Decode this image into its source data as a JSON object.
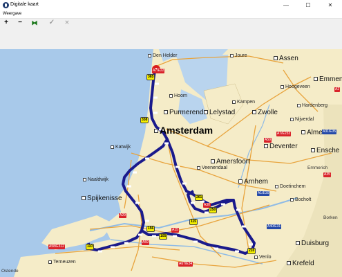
{
  "window": {
    "title": "Digitale kaart",
    "controls": [
      "—",
      "☐",
      "✕"
    ]
  },
  "menu": {
    "items": [
      "Weergave"
    ]
  },
  "toolbar": {
    "zoom_in": "+",
    "zoom_out": "−",
    "fit": "⧓",
    "confirm": "✓",
    "cancel": "✕"
  },
  "map": {
    "cities_large": {
      "amsterdam": "Amsterdam"
    },
    "cities_medium": {
      "purmerend": "Purmerend",
      "lelystad": "Lelystad",
      "zwolle": "Zwolle",
      "deventer": "Deventer",
      "amersfoort": "Amersfoort",
      "arnhem": "Arnhem",
      "spijkenisse": "Spijkenisse",
      "duisburg": "Duisburg",
      "krefeld": "Krefeld",
      "assen": "Assen",
      "almelo": "Almelo",
      "emmen": "Emmen",
      "enschede": "Ensche"
    },
    "towns": {
      "den_helder": "Den Helder",
      "joure": "Joure",
      "hoorn": "Hoorn",
      "kampen": "Kampen",
      "hoogeveen": "Hoogeveen",
      "hardenberg": "Hardenberg",
      "nijverdal": "Nijverdal",
      "katwijk": "Katwijk",
      "veenendaal": "Veenendaal",
      "naaldwijk": "Naaldwijk",
      "doetinchem": "Doetinchem",
      "bocholt": "Bocholt",
      "terneuzen": "Terneuzen",
      "venlo": "Venlo",
      "oostende": "Ostende",
      "borken": "Borken",
      "emmerich": "Emmerich"
    },
    "shields": {
      "a7e22": "A7/E22",
      "a7e233": "A7/E233",
      "a50": "A50",
      "a35": "A35",
      "a1e30": "A1/E30",
      "a29": "A29",
      "a58e312": "A58/E312",
      "a67e34": "A67/E34",
      "a15": "A15",
      "a30": "A30",
      "a59": "A59",
      "a31e35": "A31/E35",
      "a40e31": "A40/E31",
      "a2": "A2"
    },
    "route_markers": [
      "365",
      "338",
      "261",
      "250",
      "156",
      "105",
      "110",
      "210",
      "115"
    ],
    "colors": {
      "sea": "#a8c9ea",
      "land": "#f5ecc8",
      "germany": "#ece3bc",
      "route": "#1a1a8c",
      "motorway": "#e8a33c",
      "water_inland": "#b9d4ee"
    }
  }
}
